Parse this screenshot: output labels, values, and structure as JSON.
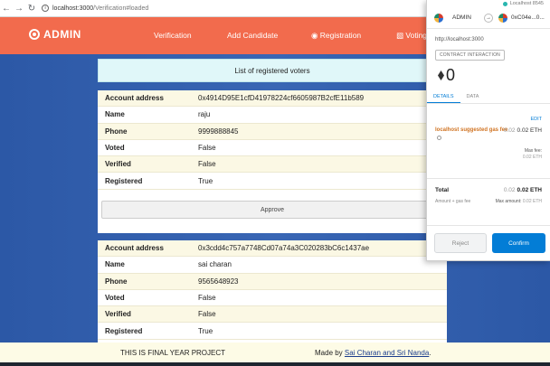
{
  "browser": {
    "back_icon": "arrow-left-icon",
    "forward_icon": "arrow-right-icon",
    "reload_icon": "reload-icon",
    "url_host": "localhost:3000",
    "url_path": "/Verification#loaded"
  },
  "app": {
    "brand": "ADMIN",
    "nav": {
      "verification": "Verification",
      "add_candidate": "Add Candidate",
      "registration": "Registration",
      "voting": "Voting"
    },
    "list_title": "List of registered voters"
  },
  "labels": {
    "account_address": "Account address",
    "name": "Name",
    "phone": "Phone",
    "voted": "Voted",
    "verified": "Verified",
    "registered": "Registered",
    "approve": "Approve"
  },
  "voters": [
    {
      "account_address": "0x4914D95E1cfD41978224cf6605987B2cfE11b589",
      "name": "raju",
      "phone": "9999888845",
      "voted": "False",
      "verified": "False",
      "registered": "True"
    },
    {
      "account_address": "0x3cdd4c757a7748Cd07a74a3C020283bC6c1437ae",
      "name": "sai charan",
      "phone": "9565648923",
      "voted": "False",
      "verified": "False",
      "registered": "True"
    }
  ],
  "footer": {
    "left": "THIS IS FINAL YEAR PROJECT",
    "made_by": "Made by",
    "authors": "Sai Charan and Sri Nanda",
    "period": "."
  },
  "metamask": {
    "network": "Localhost 8545",
    "from_account": "ADMIN",
    "to_account": "0xC04e...0...",
    "origin": "http://localhost:3000",
    "interaction_badge": "CONTRACT INTERACTION",
    "amount": "0",
    "tabs": {
      "details": "DETAILS",
      "data": "DATA"
    },
    "edit": "EDIT",
    "gas_label": "localhost suggested gas fee",
    "gas_secondary": "0.02",
    "gas_primary": "0.02 ETH",
    "max_fee_label": "Max fee:",
    "max_fee_value": "0.02 ETH",
    "total_label": "Total",
    "total_secondary": "0.02",
    "total_primary": "0.02 ETH",
    "amount_gas_label": "Amount + gas fee",
    "max_amount_label": "Max amount:",
    "max_amount_value": "0.02 ETH",
    "reject": "Reject",
    "confirm": "Confirm"
  }
}
